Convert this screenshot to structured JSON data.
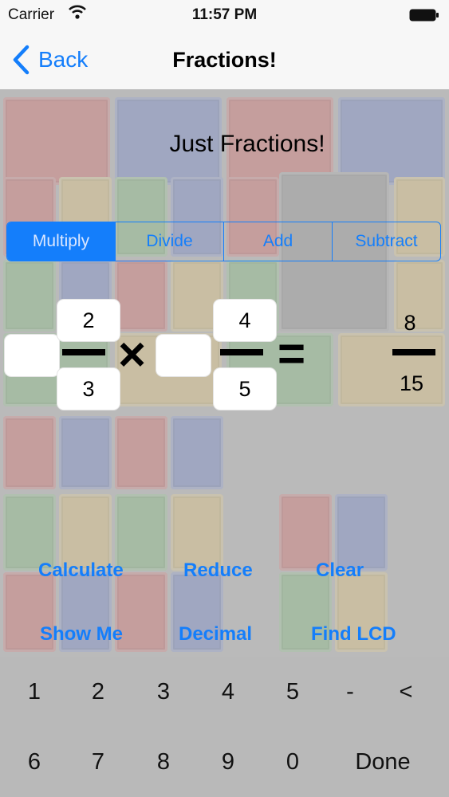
{
  "status": {
    "carrier": "Carrier",
    "time": "11:57 PM"
  },
  "nav": {
    "back_label": "Back",
    "title": "Fractions!"
  },
  "heading": "Just Fractions!",
  "operations": [
    "Multiply",
    "Divide",
    "Add",
    "Subtract"
  ],
  "selected_operation": "Multiply",
  "fraction1": {
    "whole": "",
    "numerator": "2",
    "denominator": "3"
  },
  "operator_symbol": "×",
  "fraction2": {
    "whole": "",
    "numerator": "4",
    "denominator": "5"
  },
  "equals_symbol": "=",
  "result": {
    "numerator": "8",
    "denominator": "15"
  },
  "actions": [
    "Calculate",
    "Reduce",
    "Clear",
    "Show Me",
    "Decimal",
    "Find LCD"
  ],
  "keyboard": {
    "row1": [
      "1",
      "2",
      "3",
      "4",
      "5",
      "-",
      "<"
    ],
    "row2": [
      "6",
      "7",
      "8",
      "9",
      "0",
      "Done"
    ]
  },
  "colors": {
    "accent": "#147efb"
  }
}
